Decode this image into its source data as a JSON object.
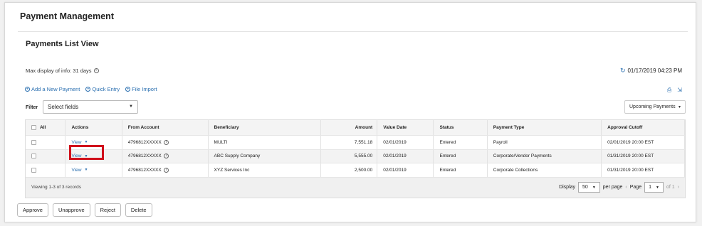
{
  "app": {
    "title": "Payment Management"
  },
  "section": {
    "title": "Payments List View"
  },
  "max_display": "Max display of info: 31 days",
  "refresh_timestamp": "01/17/2019 04:23 PM",
  "action_links": [
    {
      "label": "Add a New Payment"
    },
    {
      "label": "Quick Entry"
    },
    {
      "label": "File Import"
    }
  ],
  "filter": {
    "label": "Filter",
    "value": "Select fields"
  },
  "view_select": {
    "value": "Upcoming Payments"
  },
  "table": {
    "headers": {
      "all": "All",
      "actions": "Actions",
      "from": "From Account",
      "beneficiary": "Beneficiary",
      "amount": "Amount",
      "value_date": "Value Date",
      "status": "Status",
      "payment_type": "Payment Type",
      "approval_cutoff": "Approval Cutoff"
    },
    "rows": [
      {
        "action": "View",
        "from": "4796812XXXXX",
        "beneficiary": "MULTI",
        "amount": "7,551.18",
        "value_date": "02/01/2019",
        "status": "Entered",
        "payment_type": "Payroll",
        "cutoff": "02/01/2019 20:00 EST"
      },
      {
        "action": "View",
        "from": "4796812XXXXX",
        "beneficiary": "ABC Supply Company",
        "amount": "5,555.00",
        "value_date": "02/01/2019",
        "status": "Entered",
        "payment_type": "Corporate/Vendor Payments",
        "cutoff": "01/31/2019 20:00 EST"
      },
      {
        "action": "View",
        "from": "4796812XXXXX",
        "beneficiary": "XYZ Services Inc",
        "amount": "2,500.00",
        "value_date": "02/01/2019",
        "status": "Entered",
        "payment_type": "Corporate Collections",
        "cutoff": "01/31/2019 20:00 EST"
      }
    ]
  },
  "footer": {
    "records_text": "Viewing 1-3 of 3 records",
    "display_label": "Display",
    "page_size": "50",
    "per_page_label": "per page",
    "page_label": "Page",
    "page_number": "1",
    "of_label": "of 1"
  },
  "buttons": {
    "approve": "Approve",
    "unapprove": "Unapprove",
    "reject": "Reject",
    "delete": "Delete"
  },
  "colors": {
    "link": "#2a6fb0",
    "highlight": "#d0101b"
  }
}
